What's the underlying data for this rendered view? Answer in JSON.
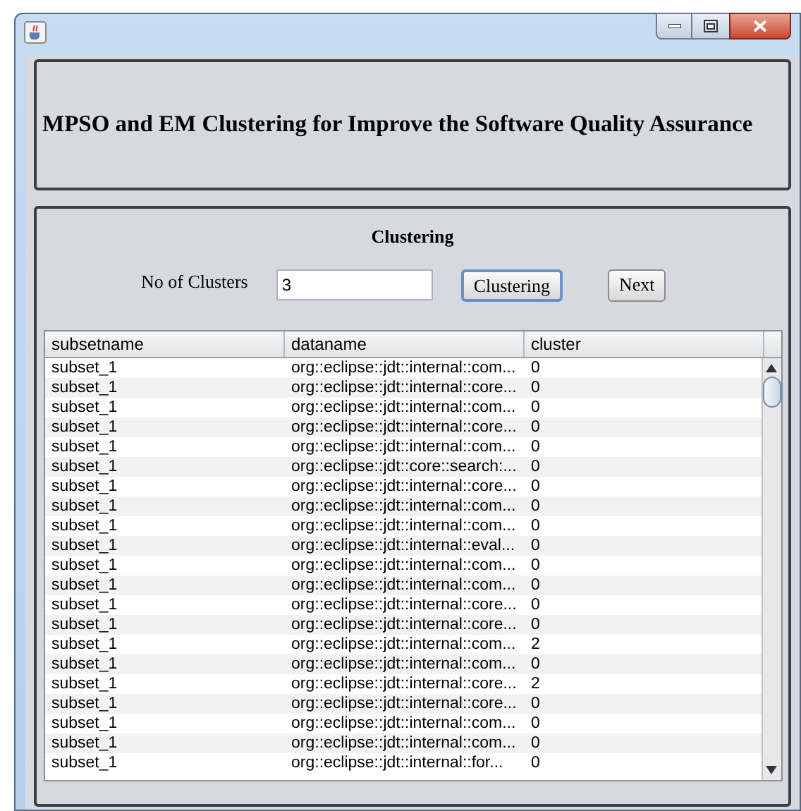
{
  "window": {
    "title_buttons": [
      {
        "kind": "minimize"
      },
      {
        "kind": "maximize"
      },
      {
        "kind": "close"
      }
    ]
  },
  "header": {
    "title": "MPSO and EM Clustering for Improve the Software Quality Assurance"
  },
  "panel": {
    "title": "Clustering",
    "field_label": "No of Clusters",
    "field_value": "3",
    "buttons": [
      {
        "label": "Clustering",
        "focused": true
      },
      {
        "label": "Next",
        "focused": false
      }
    ]
  },
  "table": {
    "columns": [
      "subsetname",
      "dataname",
      "cluster"
    ],
    "rows": [
      [
        "subset_1",
        "org::eclipse::jdt::internal::com...",
        "0"
      ],
      [
        "subset_1",
        "org::eclipse::jdt::internal::core...",
        "0"
      ],
      [
        "subset_1",
        "org::eclipse::jdt::internal::com...",
        "0"
      ],
      [
        "subset_1",
        "org::eclipse::jdt::internal::core...",
        "0"
      ],
      [
        "subset_1",
        "org::eclipse::jdt::internal::com...",
        "0"
      ],
      [
        "subset_1",
        "org::eclipse::jdt::core::search:...",
        "0"
      ],
      [
        "subset_1",
        "org::eclipse::jdt::internal::core...",
        "0"
      ],
      [
        "subset_1",
        "org::eclipse::jdt::internal::com...",
        "0"
      ],
      [
        "subset_1",
        "org::eclipse::jdt::internal::com...",
        "0"
      ],
      [
        "subset_1",
        "org::eclipse::jdt::internal::eval...",
        "0"
      ],
      [
        "subset_1",
        "org::eclipse::jdt::internal::com...",
        "0"
      ],
      [
        "subset_1",
        "org::eclipse::jdt::internal::com...",
        "0"
      ],
      [
        "subset_1",
        "org::eclipse::jdt::internal::core...",
        "0"
      ],
      [
        "subset_1",
        "org::eclipse::jdt::internal::core...",
        "0"
      ],
      [
        "subset_1",
        "org::eclipse::jdt::internal::com...",
        "2"
      ],
      [
        "subset_1",
        "org::eclipse::jdt::internal::com...",
        "0"
      ],
      [
        "subset_1",
        "org::eclipse::jdt::internal::core...",
        "2"
      ],
      [
        "subset_1",
        "org::eclipse::jdt::internal::core...",
        "0"
      ],
      [
        "subset_1",
        "org::eclipse::jdt::internal::com...",
        "0"
      ],
      [
        "subset_1",
        "org::eclipse::jdt::internal::com...",
        "0"
      ],
      [
        "subset_1",
        "org::eclipse::jdt::internal::for...",
        "0"
      ]
    ]
  }
}
